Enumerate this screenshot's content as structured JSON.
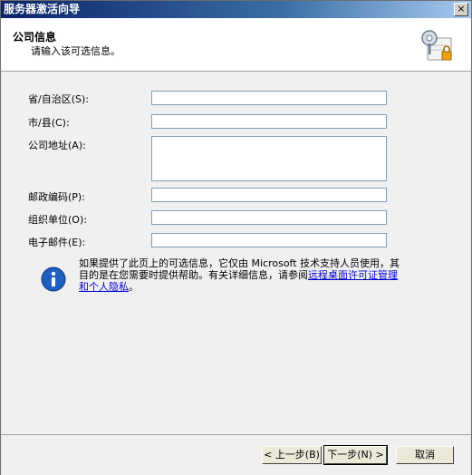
{
  "window": {
    "title": "服务器激活向导",
    "close_label": "×"
  },
  "header": {
    "title": "公司信息",
    "subtitle": "请输入该可选信息。"
  },
  "form": {
    "state_label": "省/自治区(S):",
    "state_value": "",
    "city_label": "市/县(C):",
    "city_value": "",
    "address_label": "公司地址(A):",
    "address_value": "",
    "zip_label": "邮政编码(P):",
    "zip_value": "",
    "org_label": "组织单位(O):",
    "org_value": "",
    "email_label": "电子邮件(E):",
    "email_value": ""
  },
  "info": {
    "text": "如果提供了此页上的可选信息，它仅由 Microsoft 技术支持人员使用，其目的是在您需要时提供帮助。有关详细信息，请参阅",
    "link1": "远程桌面许可证管理",
    "link2": "和个人隐私",
    "suffix": "。"
  },
  "footer": {
    "back_label": "< 上一步(B)",
    "next_label": "下一步(N) >",
    "cancel_label": "取消"
  }
}
